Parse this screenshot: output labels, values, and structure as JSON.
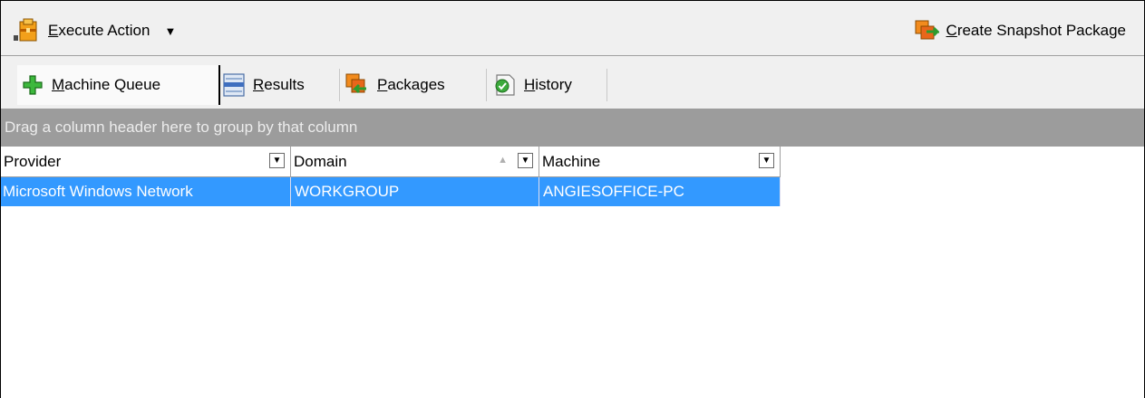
{
  "toolbar": {
    "execute_action_label": "Execute Action",
    "create_snapshot_label": "Create Snapshot Package"
  },
  "tabs": [
    {
      "label": "Machine Queue",
      "icon": "plus-icon",
      "active": true
    },
    {
      "label": "Results",
      "icon": "results-icon",
      "active": false
    },
    {
      "label": "Packages",
      "icon": "packages-icon",
      "active": false
    },
    {
      "label": "History",
      "icon": "history-icon",
      "active": false
    }
  ],
  "group_panel": {
    "hint": "Drag a column header here to group by that column"
  },
  "grid": {
    "columns": [
      "Provider",
      "Domain",
      "Machine"
    ],
    "rows": [
      {
        "provider": "Microsoft Windows Network",
        "domain": "WORKGROUP",
        "machine": "ANGIESOFFICE-PC"
      }
    ]
  },
  "colors": {
    "selection": "#3399ff",
    "group_panel": "#9c9c9c",
    "toolbar": "#f0f0f0"
  }
}
